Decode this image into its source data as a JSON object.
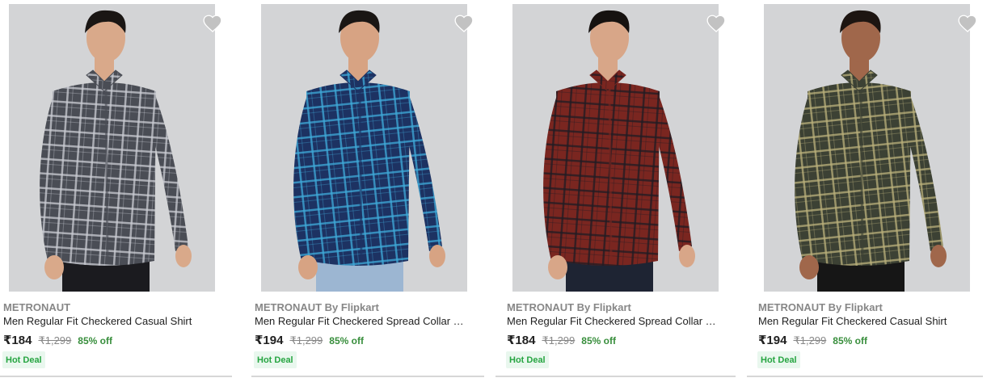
{
  "products": [
    {
      "brand": "METRONAUT",
      "title": "Men Regular Fit Checkered Casual Shirt",
      "price": "₹184",
      "mrp": "₹1,299",
      "discount": "85% off",
      "badge": "Hot Deal",
      "shirt_color": "#4a4d55",
      "shirt_line": "#c9ccd2",
      "pants_color": "#1b1b1f",
      "skin_color": "#d9a98a",
      "hair_color": "#1a1614"
    },
    {
      "brand": "METRONAUT By Flipkart",
      "title": "Men Regular Fit Checkered Spread Collar Casual Shirt",
      "price": "₹194",
      "mrp": "₹1,299",
      "discount": "85% off",
      "badge": "Hot Deal",
      "shirt_color": "#1d3262",
      "shirt_line": "#3fa9d8",
      "pants_color": "#9cb6d2",
      "skin_color": "#d7a383",
      "hair_color": "#1a1614"
    },
    {
      "brand": "METRONAUT By Flipkart",
      "title": "Men Regular Fit Checkered Spread Collar Casual Shirt",
      "price": "₹184",
      "mrp": "₹1,299",
      "discount": "85% off",
      "badge": "Hot Deal",
      "shirt_color": "#7a2620",
      "shirt_line": "#1e1a22",
      "pants_color": "#1e2433",
      "skin_color": "#d8a688",
      "hair_color": "#161210"
    },
    {
      "brand": "METRONAUT By Flipkart",
      "title": "Men Regular Fit Checkered Casual Shirt",
      "price": "₹194",
      "mrp": "₹1,299",
      "discount": "85% off",
      "badge": "Hot Deal",
      "shirt_color": "#3c4134",
      "shirt_line": "#b9b07a",
      "pants_color": "#161616",
      "skin_color": "#a0674b",
      "hair_color": "#1d1511"
    }
  ],
  "ui": {
    "background_gray": "#d3d4d6",
    "heart_color": "#c2c2c2"
  }
}
